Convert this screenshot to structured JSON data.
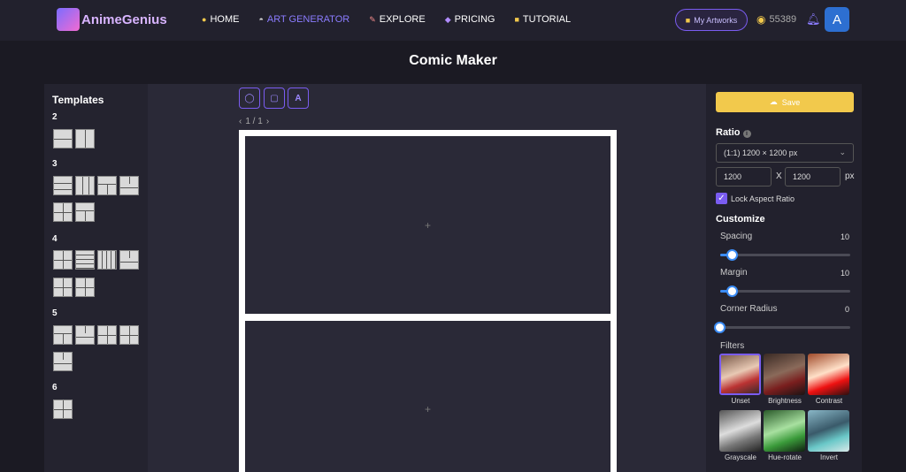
{
  "header": {
    "logo_text": "AnimeGenius",
    "nav": [
      {
        "label": "HOME",
        "icon": "home-dot-icon",
        "active": false
      },
      {
        "label": "ART GENERATOR",
        "icon": "helmet-icon",
        "active": true
      },
      {
        "label": "EXPLORE",
        "icon": "pin-icon",
        "active": false
      },
      {
        "label": "PRICING",
        "icon": "diamond-icon",
        "active": false
      },
      {
        "label": "TUTORIAL",
        "icon": "book-icon",
        "active": false
      }
    ],
    "my_artworks": "My Artworks",
    "coins": "55389",
    "avatar_letter": "A"
  },
  "page_title": "Comic Maker",
  "templates": {
    "title": "Templates",
    "groups": [
      "2",
      "3",
      "4",
      "5",
      "6"
    ]
  },
  "toolbar": {
    "pager": "1 / 1",
    "prev": "‹",
    "next": "›"
  },
  "canvas": {
    "panel_add_symbol": "+"
  },
  "settings": {
    "save_label": "Save",
    "ratio_label": "Ratio",
    "ratio_value": "(1:1) 1200 × 1200 px",
    "width": "1200",
    "height": "1200",
    "x_sep": "X",
    "unit": "px",
    "lock_label": "Lock Aspect Ratio",
    "customize_label": "Customize",
    "spacing_label": "Spacing",
    "spacing_value": "10",
    "margin_label": "Margin",
    "margin_value": "10",
    "corner_label": "Corner Radius",
    "corner_value": "0",
    "filters_label": "Filters",
    "filters": [
      "Unset",
      "Brightness",
      "Contrast",
      "Grayscale",
      "Hue-rotate",
      "Invert"
    ]
  },
  "colors": {
    "accent": "#7a5cf0",
    "save": "#f2c94c",
    "slider": "#3b8cf5"
  }
}
